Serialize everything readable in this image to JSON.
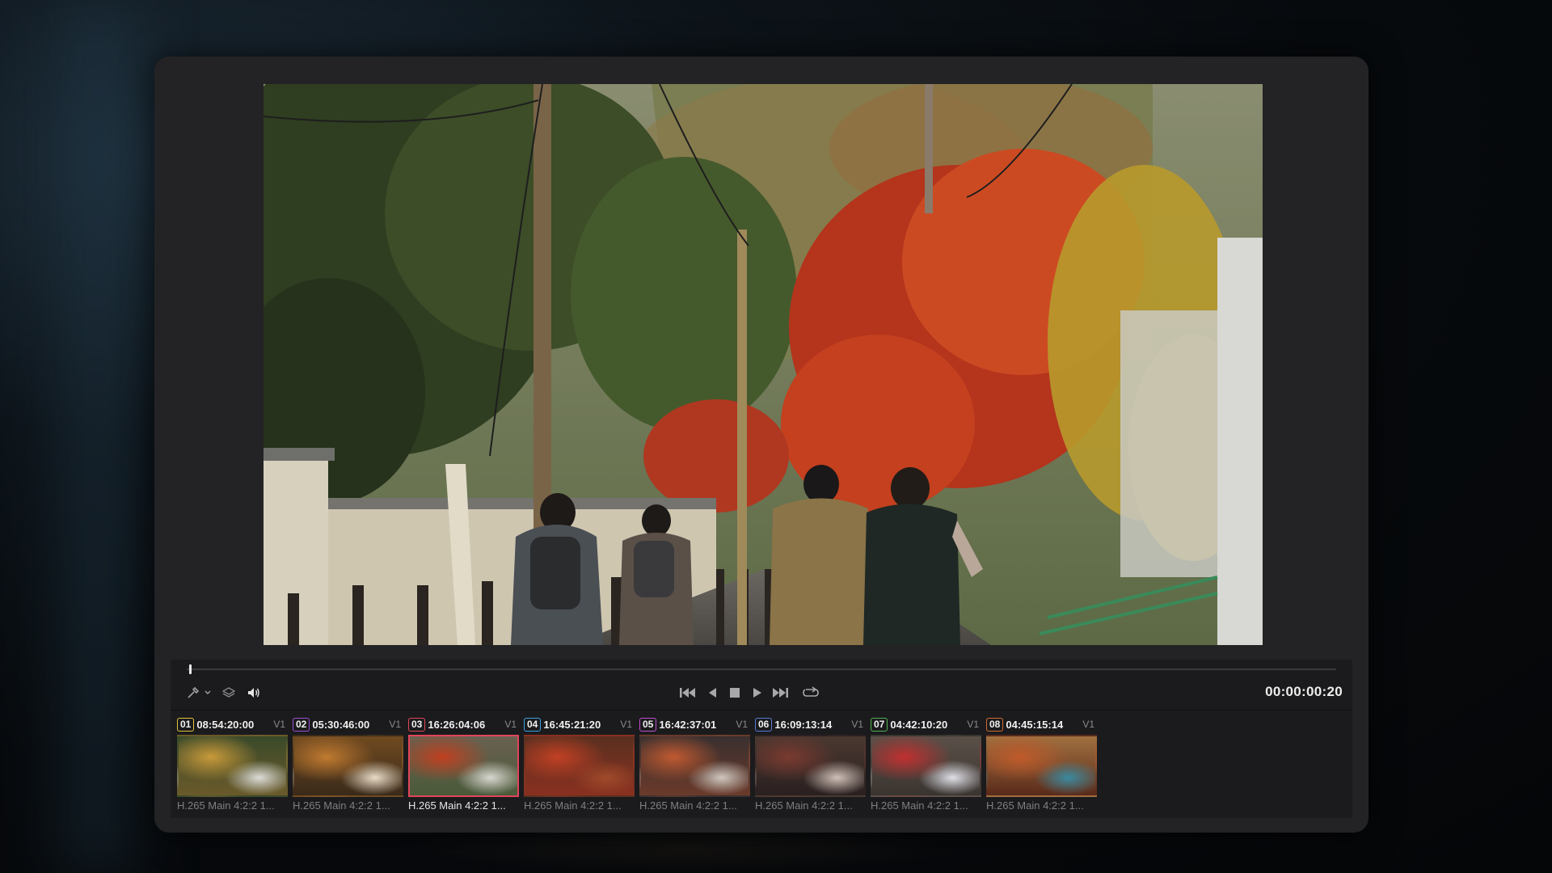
{
  "app": {
    "timecode": "00:00:00:20"
  },
  "playhead": {
    "position_fraction": 0.002
  },
  "toolbar": {
    "tools_left": [
      {
        "icon": "eyedropper-icon"
      },
      {
        "icon": "chevron-down-icon"
      },
      {
        "icon": "layers-icon"
      },
      {
        "icon": "speaker-icon"
      }
    ],
    "transport": [
      {
        "icon": "skip-to-start-icon"
      },
      {
        "icon": "step-back-icon"
      },
      {
        "icon": "stop-icon"
      },
      {
        "icon": "play-icon"
      },
      {
        "icon": "skip-to-end-icon"
      },
      {
        "icon": "loop-icon"
      }
    ]
  },
  "clips": [
    {
      "num": "01",
      "tc": "08:54:20:00",
      "track": "V1",
      "codec": "H.265 Main 4:2:2 1...",
      "badge_color": "#e0c23a",
      "active": false
    },
    {
      "num": "02",
      "tc": "05:30:46:00",
      "track": "V1",
      "codec": "H.265 Main 4:2:2 1...",
      "badge_color": "#9a4fd0",
      "active": false
    },
    {
      "num": "03",
      "tc": "16:26:04:06",
      "track": "V1",
      "codec": "H.265 Main 4:2:2 1...",
      "badge_color": "#e0455a",
      "active": true
    },
    {
      "num": "04",
      "tc": "16:45:21:20",
      "track": "V1",
      "codec": "H.265 Main 4:2:2 1...",
      "badge_color": "#3aa0e0",
      "active": false
    },
    {
      "num": "05",
      "tc": "16:42:37:01",
      "track": "V1",
      "codec": "H.265 Main 4:2:2 1...",
      "badge_color": "#c04fd0",
      "active": false
    },
    {
      "num": "06",
      "tc": "16:09:13:14",
      "track": "V1",
      "codec": "H.265 Main 4:2:2 1...",
      "badge_color": "#5a7ad8",
      "active": false
    },
    {
      "num": "07",
      "tc": "04:42:10:20",
      "track": "V1",
      "codec": "H.265 Main 4:2:2 1...",
      "badge_color": "#50b050",
      "active": false
    },
    {
      "num": "08",
      "tc": "04:45:15:14",
      "track": "V1",
      "codec": "H.265 Main 4:2:2 1...",
      "badge_color": "#d06a30",
      "active": false
    }
  ],
  "colors": {
    "accent_active": "#e0455a",
    "window_bg": "#232325",
    "panel_bg": "#1b1b1d"
  }
}
